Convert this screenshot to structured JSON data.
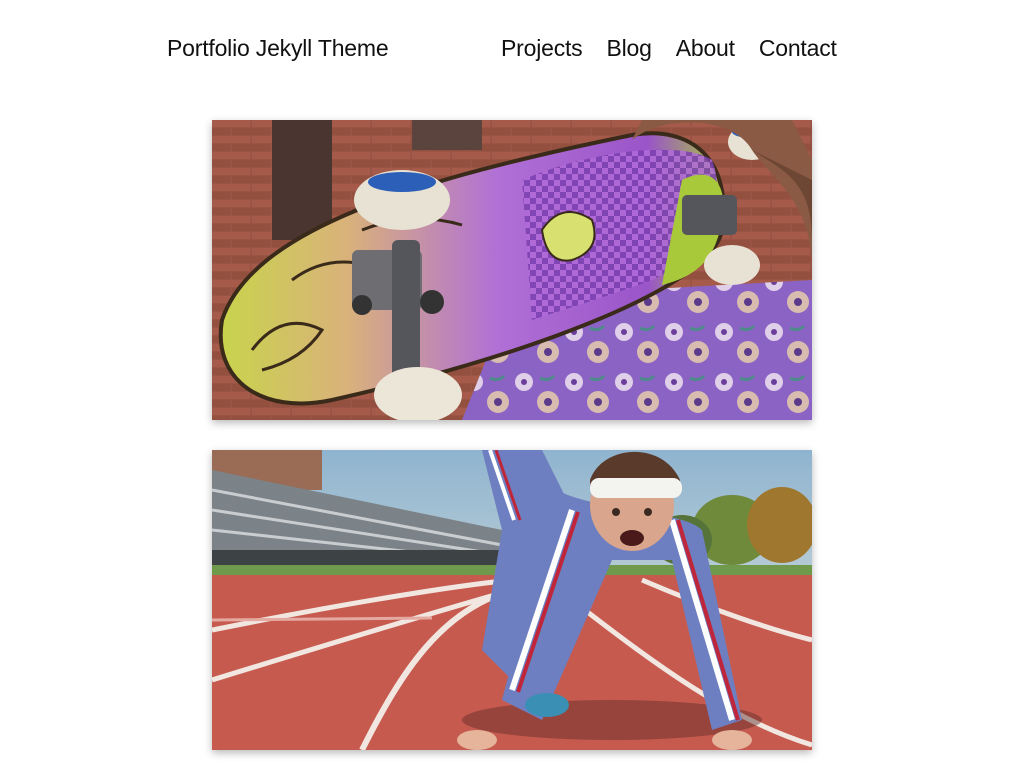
{
  "header": {
    "site_title": "Portfolio Jekyll Theme",
    "nav": [
      {
        "label": "Projects"
      },
      {
        "label": "Blog"
      },
      {
        "label": "About"
      },
      {
        "label": "Contact"
      }
    ]
  },
  "projects": [
    {
      "image": "skateboard-photo",
      "description": "Hand holding a colorful skateboard with purple checkered and green swirl artwork, person in floral shirt, brick building background"
    },
    {
      "image": "sprinter-photo",
      "description": "Person in blue tracksuit with white headband crouched in starting position on red running track, bleachers and trees in background"
    }
  ],
  "colors": {
    "text": "#111111",
    "background": "#ffffff",
    "track_red": "#c65a4f",
    "tracksuit_blue": "#6d7fc0",
    "board_purple": "#9b57c8",
    "board_green": "#a8c93a"
  }
}
